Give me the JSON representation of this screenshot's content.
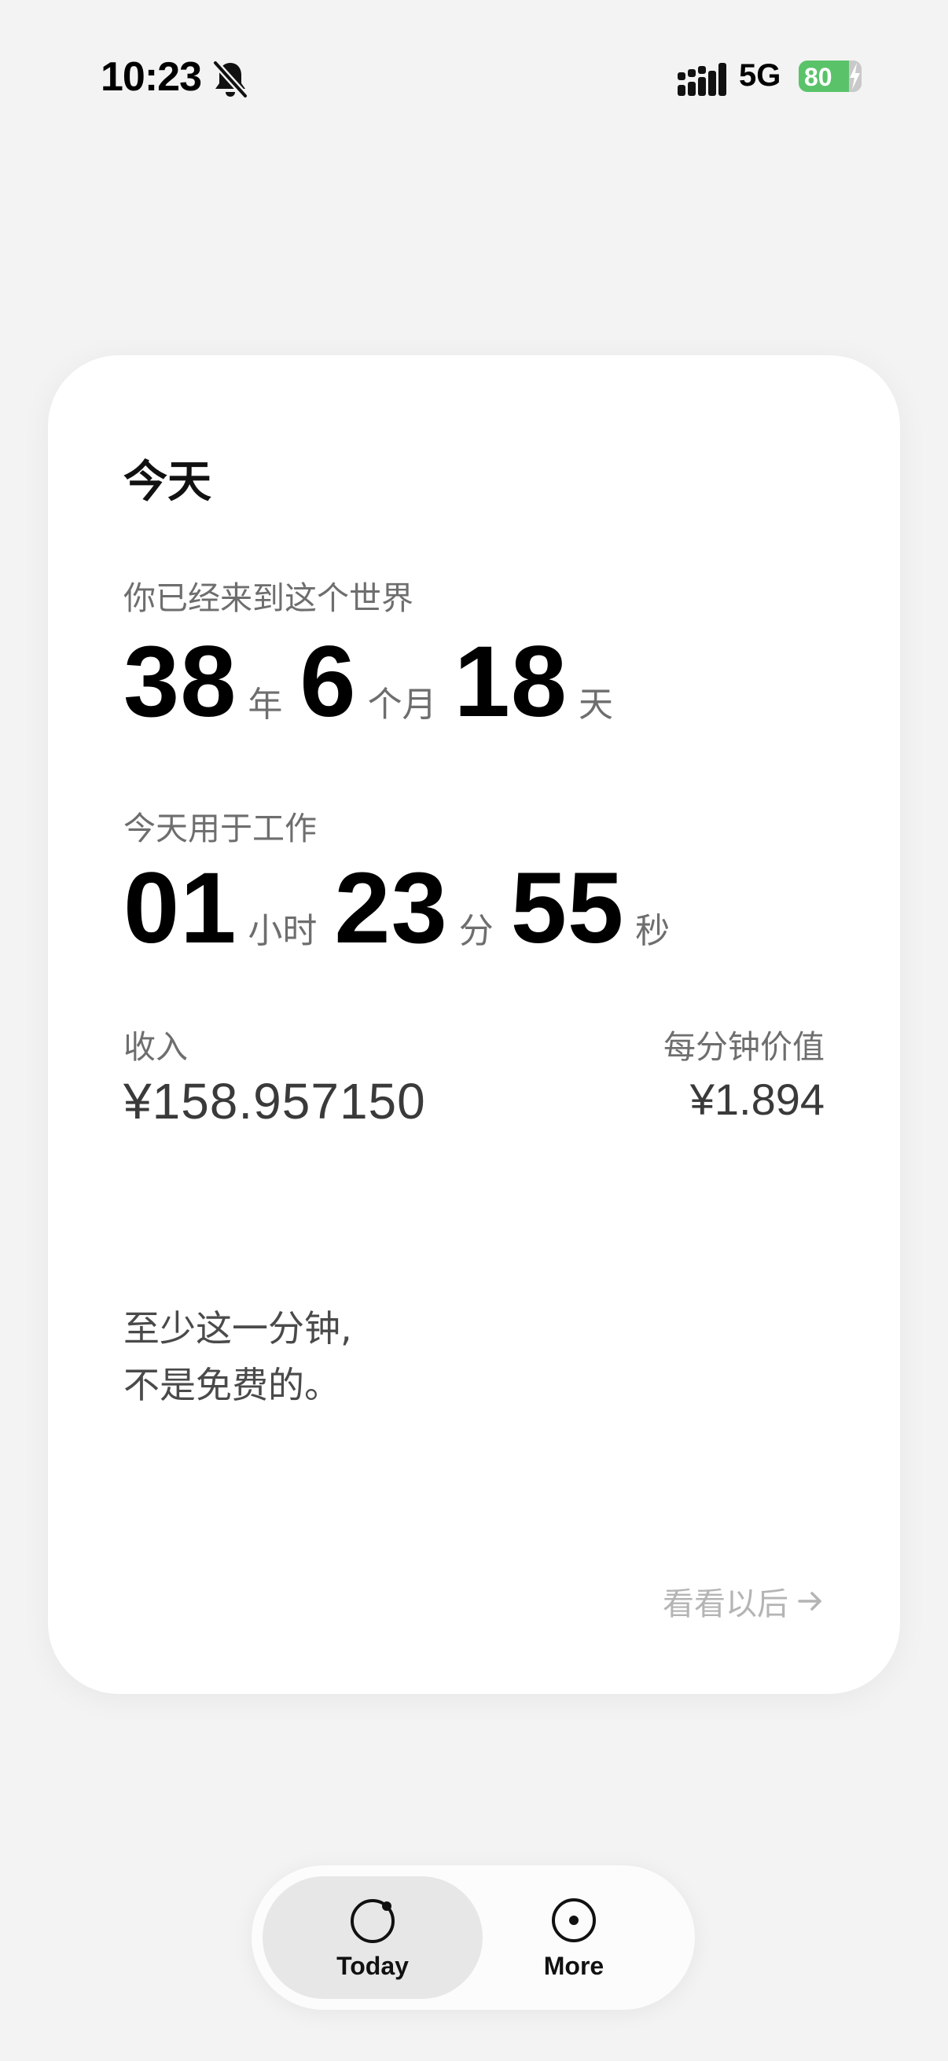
{
  "status_bar": {
    "time": "10:23",
    "network": "5G",
    "battery": "80",
    "icons": [
      "bell-slash-icon",
      "signal-bars-icon",
      "charging-bolt-icon"
    ]
  },
  "card": {
    "title": "今天",
    "age": {
      "label": "你已经来到这个世界",
      "years": "38",
      "years_unit": "年",
      "months": "6",
      "months_unit": "个月",
      "days": "18",
      "days_unit": "天"
    },
    "work": {
      "label": "今天用于工作",
      "hours": "01",
      "hours_unit": "小时",
      "minutes": "23",
      "minutes_unit": "分",
      "seconds": "55",
      "seconds_unit": "秒"
    },
    "income": {
      "label": "收入",
      "value": "¥158.957150"
    },
    "per_minute": {
      "label": "每分钟价值",
      "value": "¥1.894"
    },
    "quote": {
      "line1": "至少这一分钟,",
      "line2": "不是免费的。"
    },
    "future_link": {
      "label": "看看以后",
      "icon": "arrow-right-icon"
    }
  },
  "tab_bar": {
    "tabs": [
      {
        "label": "Today",
        "icon": "circle-dot-orbit-icon",
        "active": true
      },
      {
        "label": "More",
        "icon": "circle-center-dot-icon",
        "active": false
      }
    ]
  },
  "colors": {
    "background": "#f3f3f3",
    "card": "#ffffff",
    "battery": "#5ac36a",
    "muted_text": "#6e6e6e",
    "link_text": "#b4b4b4"
  }
}
